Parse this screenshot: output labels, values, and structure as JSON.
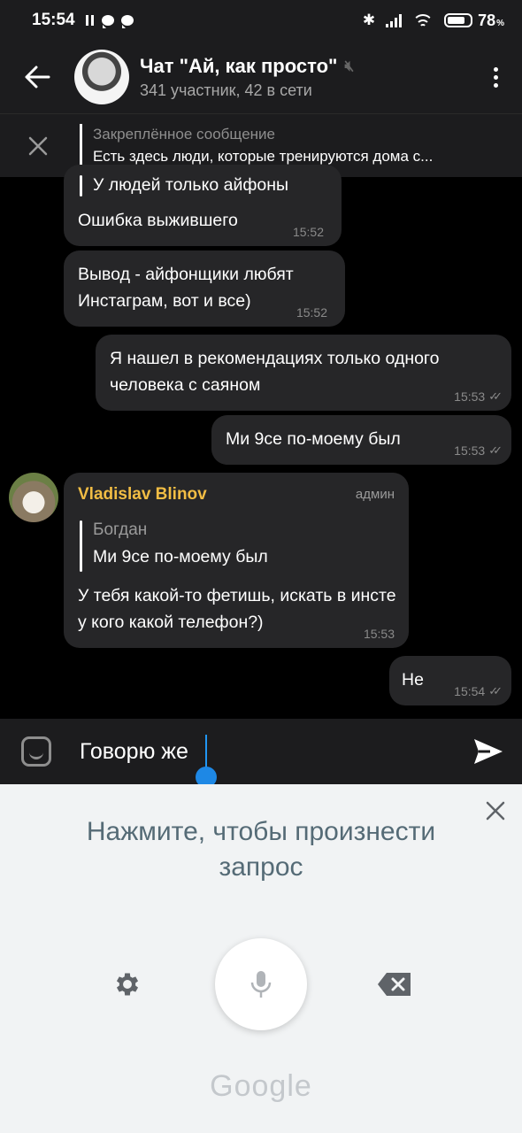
{
  "status_bar": {
    "time": "15:54",
    "battery": "78",
    "battery_unit": "%",
    "battery_level": 0.78
  },
  "header": {
    "title": "Чат \"Ай, как просто\"",
    "subtitle": "341 участник, 42 в сети"
  },
  "pinned": {
    "label": "Закреплённое сообщение",
    "text": "Есть здесь люди, которые тренируются дома с..."
  },
  "messages": [
    {
      "reply_text": "У людей только айфоны",
      "text": "Ошибка выжившего",
      "time": "15:52"
    },
    {
      "text": "Вывод - айфонщики любят Инстаграм, вот и все)",
      "time": "15:52"
    },
    {
      "text": "Я нашел в рекомендациях только одного человека с саяном",
      "time": "15:53"
    },
    {
      "text": "Ми 9се по-моему был",
      "time": "15:53"
    },
    {
      "sender": "Vladislav Blinov",
      "badge": "админ",
      "reply_name": "Богдан",
      "reply_text": "Ми 9се по-моему был",
      "text": "У тебя какой-то фетишь, искать в инсте у кого какой телефон?)",
      "time": "15:53"
    },
    {
      "text": "Не",
      "time": "15:54"
    }
  ],
  "composer": {
    "value": "Говорю же"
  },
  "voice": {
    "prompt_line1": "Нажмите, чтобы произнести",
    "prompt_line2": "запрос",
    "brand": "Google"
  },
  "colors": {
    "accent_name": "#f2bd44",
    "cursor": "#2196f3",
    "bubble": "#262628",
    "prompt": "#556b76"
  }
}
